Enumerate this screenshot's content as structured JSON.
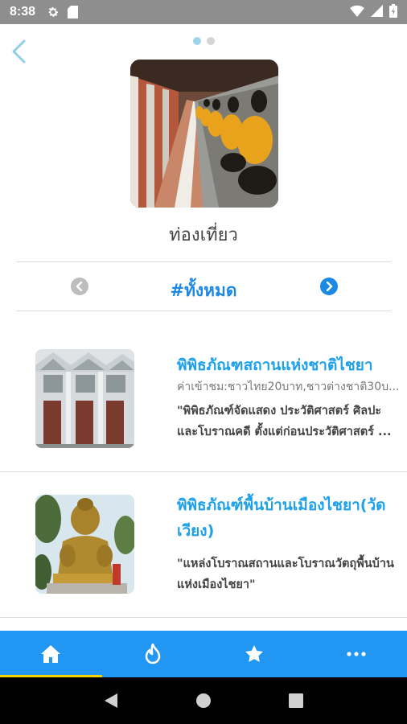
{
  "status_bar": {
    "time": "8:38",
    "left_icons": [
      "gear-icon",
      "sd-card-icon"
    ],
    "right_icons": [
      "wifi-icon",
      "signal-icon",
      "battery-icon"
    ]
  },
  "header": {
    "back_icon": "chevron-left-icon",
    "pager": {
      "count": 2,
      "active": 0
    },
    "title": "ท่องเที่ยว"
  },
  "filter": {
    "label": "#ทั้งหมด",
    "prev_icon": "chevron-left-circle-icon",
    "next_icon": "chevron-right-circle-icon"
  },
  "places": [
    {
      "title": "พิพิธภัณฑสถานแห่งชาติไชยา",
      "subtitle": "ค่าเข้าชม:ชาวไทย20บาท,ชาวต่างชาติ30บ...",
      "description": "\"พิพิธภัณฑ์จัดแสดง ประวัติศาสตร์ ศิลปะและโบราณคดี ตั้งแต่ก่อนประวัติศาสตร์ ...",
      "image": "museum-building-photo"
    },
    {
      "title": "พิพิธภัณฑ์พื้นบ้านเมืองไชยา(วัดเวียง)",
      "subtitle": "",
      "description": "\"แหล่งโบราณสถานและโบราณวัตถุพื้นบ้านแห่งเมืองไชยา\"",
      "image": "golden-buddha-statue-photo"
    }
  ],
  "bottom_nav": [
    {
      "icon": "home-icon",
      "active": true
    },
    {
      "icon": "flame-icon",
      "active": false
    },
    {
      "icon": "star-icon",
      "active": false
    },
    {
      "icon": "more-dots-icon",
      "active": false
    }
  ],
  "system_nav": [
    "back-triangle-icon",
    "home-circle-icon",
    "recents-square-icon"
  ],
  "colors": {
    "status_bar": "#8e8e8e",
    "accent": "#2196f3",
    "title_blue": "#1ea1e8",
    "active_indicator": "#f5d300",
    "pager_active": "#9fd3ea"
  }
}
